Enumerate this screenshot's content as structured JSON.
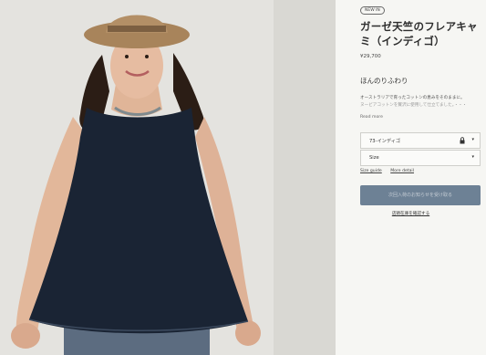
{
  "photo": {
    "alt": ""
  },
  "product": {
    "badge": "NEW IN",
    "title": "ガーゼ天竺のフレアキャミ（インディゴ）",
    "price": "¥29,700",
    "subheading": "ほんのりふわり",
    "description_line1": "オーストラリアで育ったコットンの恵みをそのままに。",
    "description_line2": "ヌービアコットンを贅沢に使用して仕立てました。・・・",
    "read_more": "Read more"
  },
  "variant_select": {
    "value": "73-インディゴ",
    "arrow": "▾"
  },
  "size_select": {
    "value": "Size",
    "arrow": "▾"
  },
  "links": {
    "size_guide": "Size guide",
    "more_detail": "More detail"
  },
  "cta": {
    "label": "次回入荷のお知らせを受け取る"
  },
  "stock_link": {
    "label": "店頭在庫を確認する"
  },
  "colors": {
    "cta_bg": "#6d8195",
    "panel_bg": "#f6f6f3",
    "shirt": "#1a2434"
  }
}
